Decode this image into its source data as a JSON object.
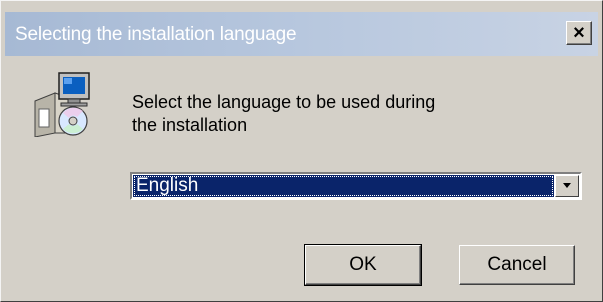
{
  "dialog": {
    "title": "Selecting the installation language",
    "message_line1": "Select the language to be used during",
    "message_line2": "the installation",
    "language": {
      "selected": "English"
    },
    "buttons": {
      "ok": "OK",
      "cancel": "Cancel"
    },
    "close_glyph": "×"
  },
  "icons": {
    "title_close": "close-icon",
    "setup": "setup-installer-icon",
    "dropdown": "chevron-down-icon"
  },
  "colors": {
    "dialog_bg": "#d4d0c8",
    "title_gradient_start": "#a6b9d4",
    "title_gradient_end": "#c8d3e4",
    "selection_bg": "#0a246a"
  }
}
